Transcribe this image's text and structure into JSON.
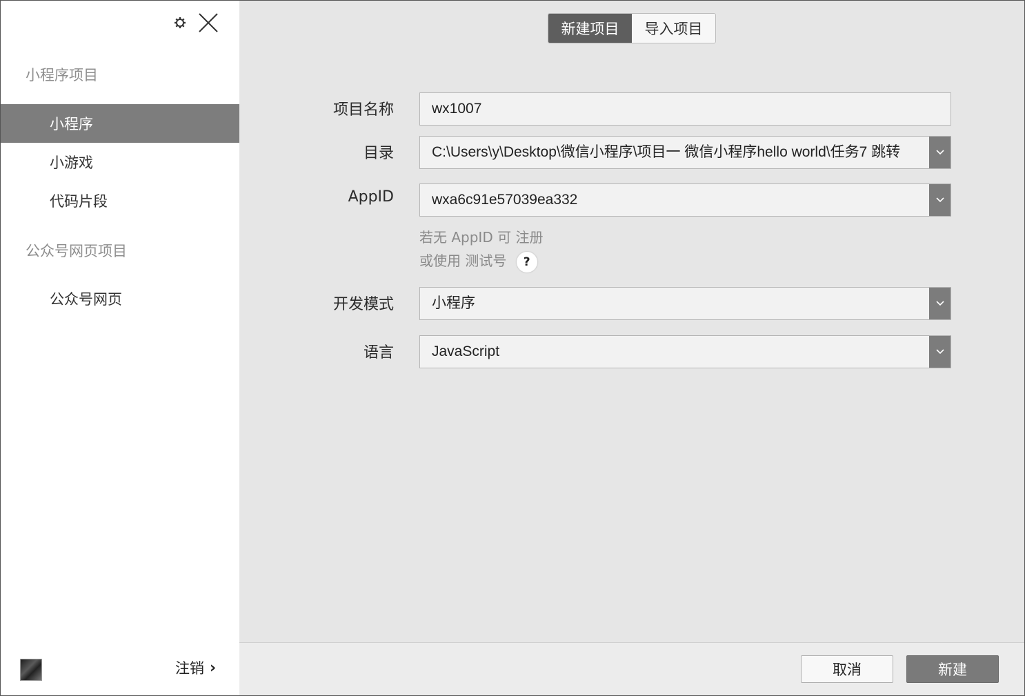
{
  "sidebar": {
    "section_miniprogram": "小程序项目",
    "items_miniprogram": [
      {
        "label": "小程序",
        "active": true
      },
      {
        "label": "小游戏",
        "active": false
      },
      {
        "label": "代码片段",
        "active": false
      }
    ],
    "section_official": "公众号网页项目",
    "items_official": [
      {
        "label": "公众号网页",
        "active": false
      }
    ],
    "logout_label": "注销",
    "logout_chevron": "›"
  },
  "tabs": [
    {
      "label": "新建项目",
      "active": true
    },
    {
      "label": "导入项目",
      "active": false
    }
  ],
  "form": {
    "project_name": {
      "label": "项目名称",
      "value": "wx1007"
    },
    "directory": {
      "label": "目录",
      "value": "C:\\Users\\y\\Desktop\\微信小程序\\项目一 微信小程序hello world\\任务7 跳转"
    },
    "appid": {
      "label": "AppID",
      "value": "wxa6c91e57039ea332"
    },
    "appid_hint": {
      "prefix": "若无 AppID 可",
      "register_link": "注册",
      "or_use": "或使用",
      "test_link": "测试号",
      "help_glyph": "?"
    },
    "dev_mode": {
      "label": "开发模式",
      "value": "小程序"
    },
    "language": {
      "label": "语言",
      "value": "JavaScript"
    }
  },
  "footer": {
    "cancel_label": "取消",
    "create_label": "新建"
  },
  "colors": {
    "sidebar_active_bg": "#7d7d7d",
    "tab_active_bg": "#5e5e5e",
    "main_bg": "#e6e6e6",
    "dropdown_btn_bg": "#7c7c7c",
    "create_btn_bg": "#7a7a7a"
  },
  "icons": [
    "gear-icon",
    "close-icon",
    "chevron-down-icon",
    "chevron-right-icon",
    "help-icon"
  ]
}
